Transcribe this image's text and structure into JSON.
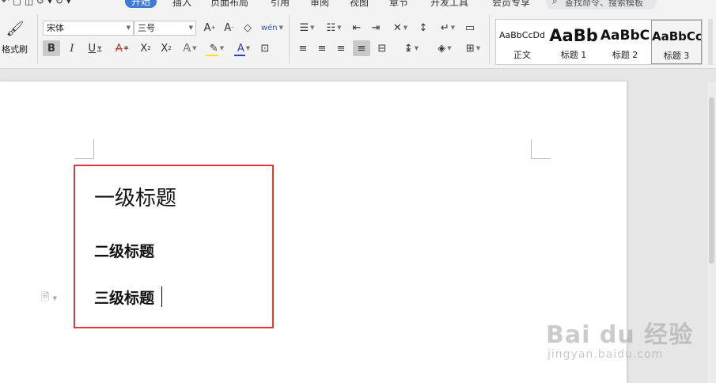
{
  "menubar": {
    "tabs": [
      "开始",
      "插入",
      "页面布局",
      "引用",
      "审阅",
      "视图",
      "章节",
      "开发工具",
      "会员专享"
    ],
    "active_tab": "开始",
    "search_placeholder": "查找命令、搜索模板"
  },
  "ribbon": {
    "format_painter_label": "格式刷",
    "font_name": "宋体",
    "font_size": "三号",
    "styles": [
      {
        "preview": "AaBbCcDd",
        "label": "正文"
      },
      {
        "preview": "AaBb",
        "label": "标题 1"
      },
      {
        "preview": "AaBbC",
        "label": "标题 2"
      },
      {
        "preview": "AaBbCc",
        "label": "标题 3"
      }
    ],
    "colors": {
      "highlight": "#f5e12a",
      "font_color": "#2a3fd6",
      "red_underline": "#e0322a"
    }
  },
  "document": {
    "heading1": "一级标题",
    "heading2": "二级标题",
    "heading3": "三级标题",
    "highlight_box_color": "#e03a3a"
  },
  "watermark": {
    "brand": "Bai du 经验",
    "sub": "jingyan.baidu.com"
  }
}
